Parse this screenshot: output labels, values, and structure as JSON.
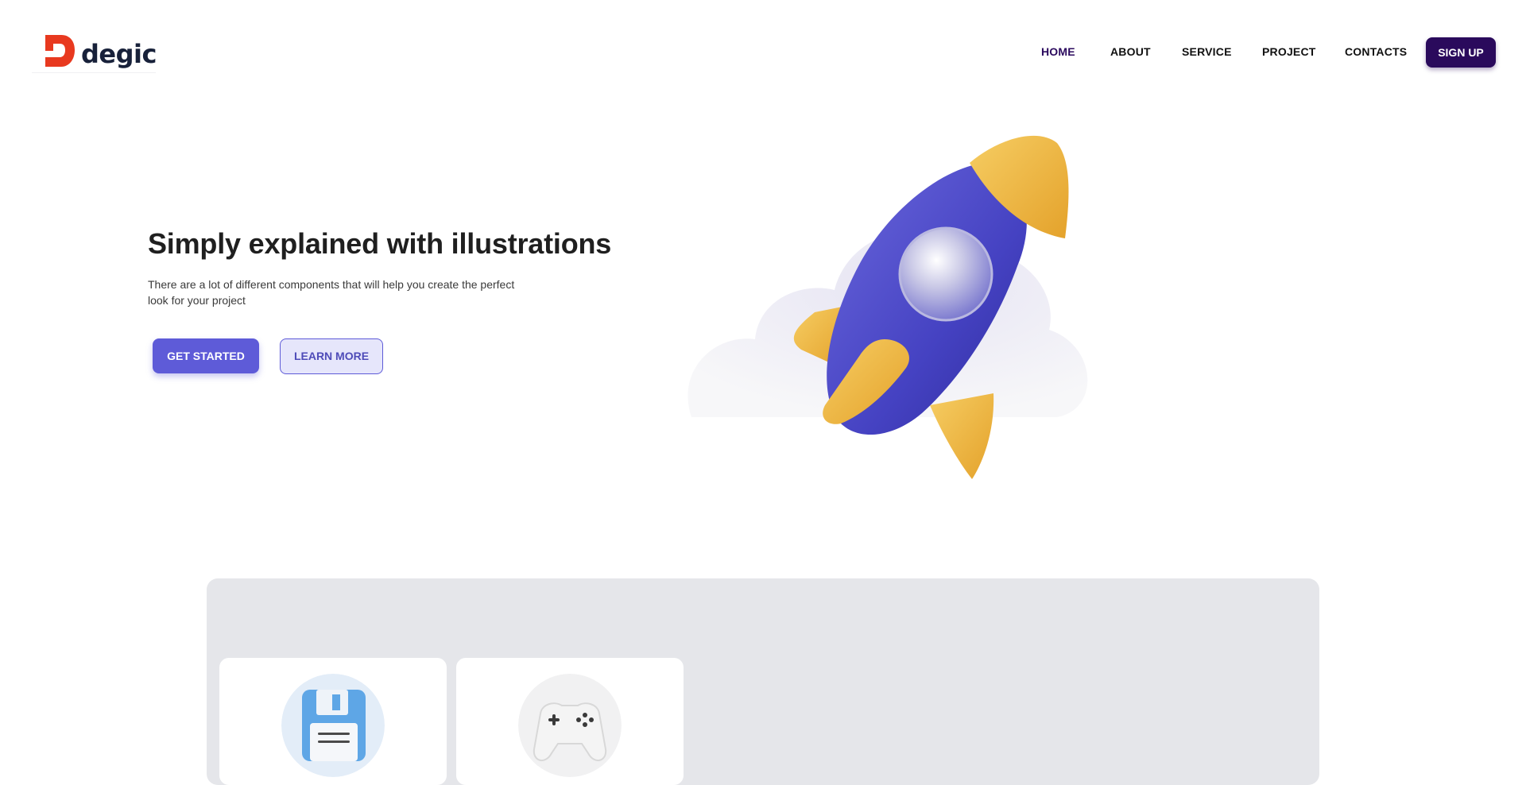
{
  "header": {
    "logo_text": "degic",
    "logo_color": "#e8391f",
    "nav": [
      {
        "label": "HOME",
        "active": true
      },
      {
        "label": "ABOUT",
        "active": false
      },
      {
        "label": "SERVICE",
        "active": false
      },
      {
        "label": "PROJECT",
        "active": false
      },
      {
        "label": "CONTACTS",
        "active": false
      }
    ],
    "signup_label": "SIGN UP"
  },
  "hero": {
    "title": "Simply explained with illustrations",
    "description": "There are a lot of different components that will help you create the perfect look for your project",
    "primary_cta": "GET STARTED",
    "secondary_cta": "LEARN MORE",
    "illustration": "rocket-icon"
  },
  "features": {
    "cards": [
      {
        "icon": "floppy-disk-icon"
      },
      {
        "icon": "gamepad-icon"
      }
    ]
  },
  "colors": {
    "accent": "#5e5bd8",
    "brand_dark": "#2a0a5c",
    "rocket_body": "#4a47c9",
    "rocket_fin": "#f0b93a",
    "panel_bg": "#e5e6ea"
  }
}
